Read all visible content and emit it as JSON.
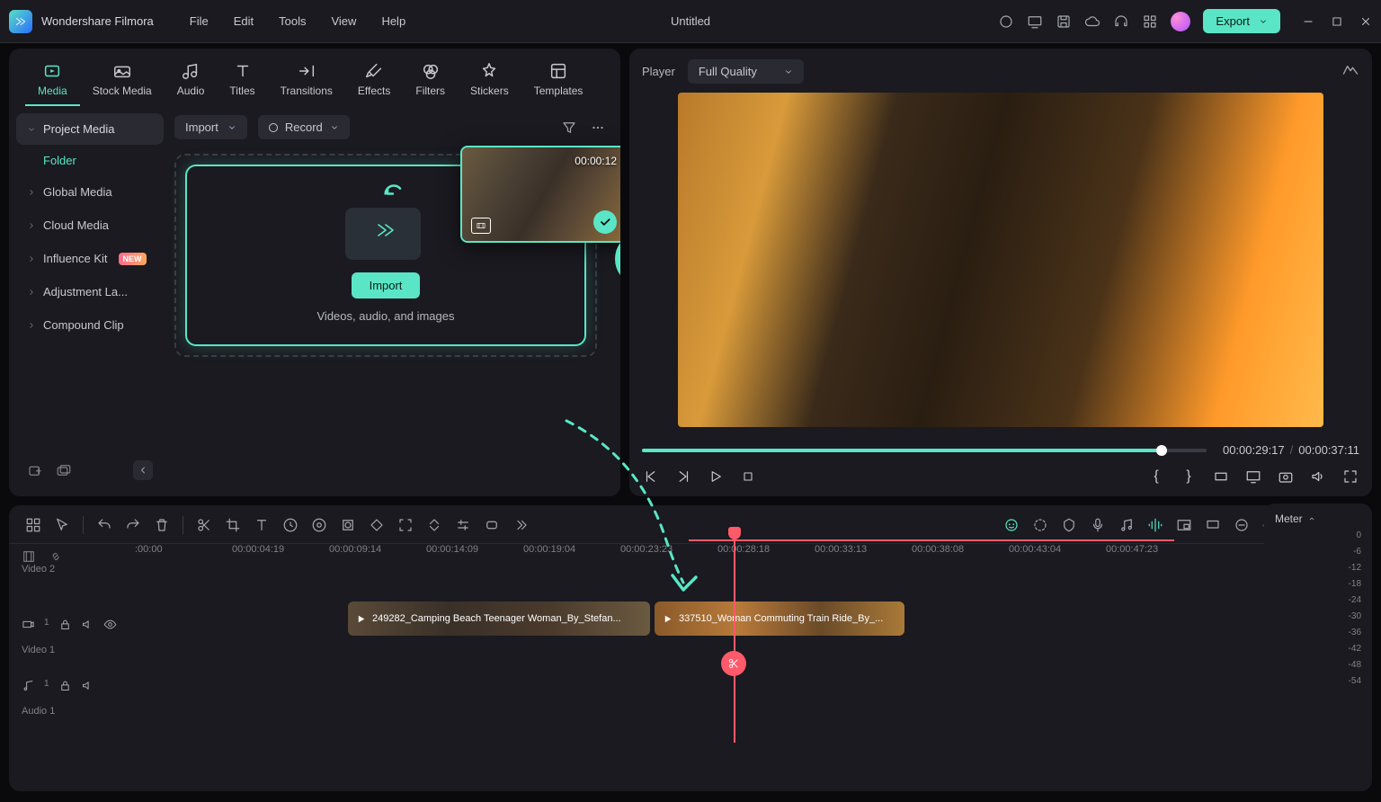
{
  "app": {
    "name": "Wondershare Filmora",
    "doc": "Untitled"
  },
  "menus": [
    "File",
    "Edit",
    "Tools",
    "View",
    "Help"
  ],
  "export": "Export",
  "tabs": [
    {
      "k": "media",
      "label": "Media",
      "active": true
    },
    {
      "k": "stock",
      "label": "Stock Media"
    },
    {
      "k": "audio",
      "label": "Audio"
    },
    {
      "k": "titles",
      "label": "Titles"
    },
    {
      "k": "transitions",
      "label": "Transitions"
    },
    {
      "k": "effects",
      "label": "Effects"
    },
    {
      "k": "filters",
      "label": "Filters"
    },
    {
      "k": "stickers",
      "label": "Stickers"
    },
    {
      "k": "templates",
      "label": "Templates"
    }
  ],
  "sidebar": {
    "items": [
      {
        "label": "Project Media",
        "sel": true,
        "sub": "Folder"
      },
      {
        "label": "Global Media"
      },
      {
        "label": "Cloud Media"
      },
      {
        "label": "Influence Kit",
        "badge": "NEW"
      },
      {
        "label": "Adjustment La..."
      },
      {
        "label": "Compound Clip"
      }
    ]
  },
  "importBtns": {
    "importDD": "Import",
    "recordDD": "Record",
    "importPill": "Import",
    "dropTxt": "Videos, audio, and images"
  },
  "thumb": {
    "duration": "00:00:12"
  },
  "player": {
    "label": "Player",
    "quality": "Full Quality",
    "cur": "00:00:29:17",
    "dur": "00:00:37:11"
  },
  "ruler": [
    ":00:00",
    "00:00:04:19",
    "00:00:09:14",
    "00:00:14:09",
    "00:00:19:04",
    "00:00:23:23",
    "00:00:28:18",
    "00:00:33:13",
    "00:00:38:08",
    "00:00:43:04",
    "00:00:47:23"
  ],
  "tracks": {
    "video2": "Video 2",
    "video1": "Video 1",
    "audio1": "Audio 1"
  },
  "clips": {
    "c1": "249282_Camping Beach Teenager Woman_By_Stefan...",
    "c2": "337510_Woman Commuting Train Ride_By_..."
  },
  "meter": {
    "label": "Meter",
    "ticks": [
      "0",
      "-6",
      "-12",
      "-18",
      "-24",
      "-30",
      "-36",
      "-42",
      "-48",
      "-54"
    ]
  }
}
